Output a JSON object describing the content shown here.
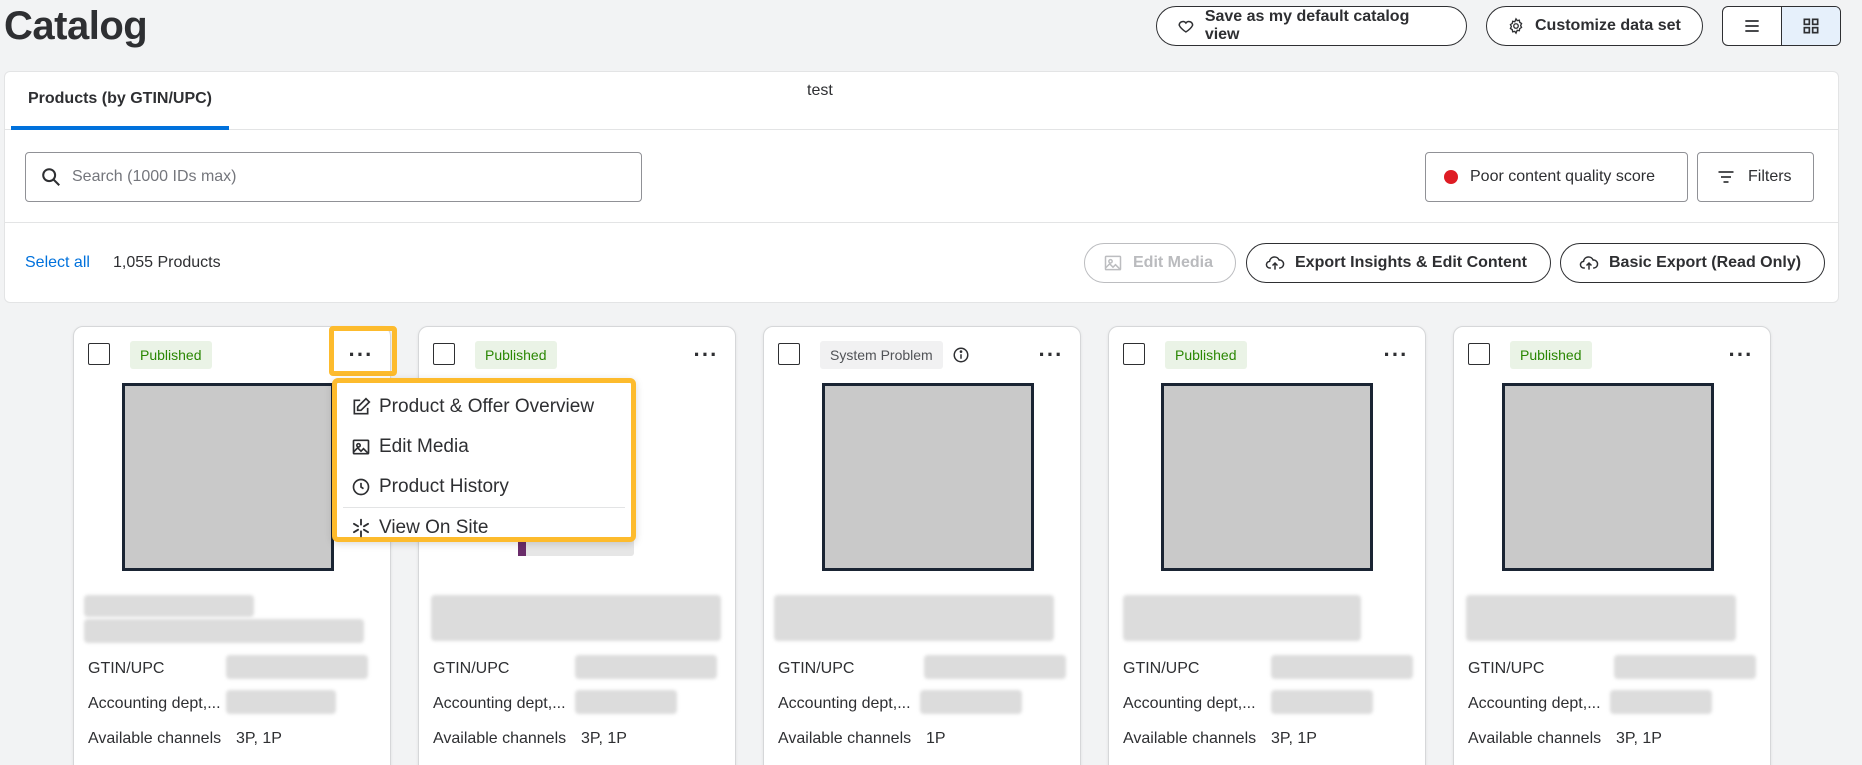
{
  "header": {
    "title": "Catalog",
    "save_view_label": "Save as my default catalog view",
    "customize_label": "Customize data set"
  },
  "tabs": [
    {
      "label": "Products (by GTIN/UPC)",
      "active": true
    }
  ],
  "test_label": "test",
  "search": {
    "placeholder": "Search (1000 IDs max)",
    "value": ""
  },
  "quality_filter_label": "Poor content quality score",
  "filters_label": "Filters",
  "toolbar": {
    "select_all": "Select all",
    "count": "1,055 Products",
    "edit_media": "Edit Media",
    "export_insights": "Export Insights & Edit Content",
    "basic_export": "Basic Export (Read Only)"
  },
  "cards": [
    {
      "status": "Published",
      "channels": "3P, 1P"
    },
    {
      "status": "Published",
      "channels": "3P, 1P"
    },
    {
      "status": "System Problem",
      "channels": "1P"
    },
    {
      "status": "Published",
      "channels": "3P, 1P"
    },
    {
      "status": "Published",
      "channels": "3P, 1P"
    }
  ],
  "card_labels": {
    "gtin": "GTIN/UPC",
    "accounting": "Accounting dept,...",
    "channels": "Available channels"
  },
  "menu": {
    "overview": "Product & Offer Overview",
    "edit_media": "Edit Media",
    "history": "Product History",
    "view_site": "View On Site"
  },
  "colors": {
    "accent": "#0071dc",
    "highlight": "#fdbb2d",
    "published_text": "#2a8703",
    "published_bg": "#eaf3e6",
    "poor_quality_dot": "#de1c24"
  }
}
